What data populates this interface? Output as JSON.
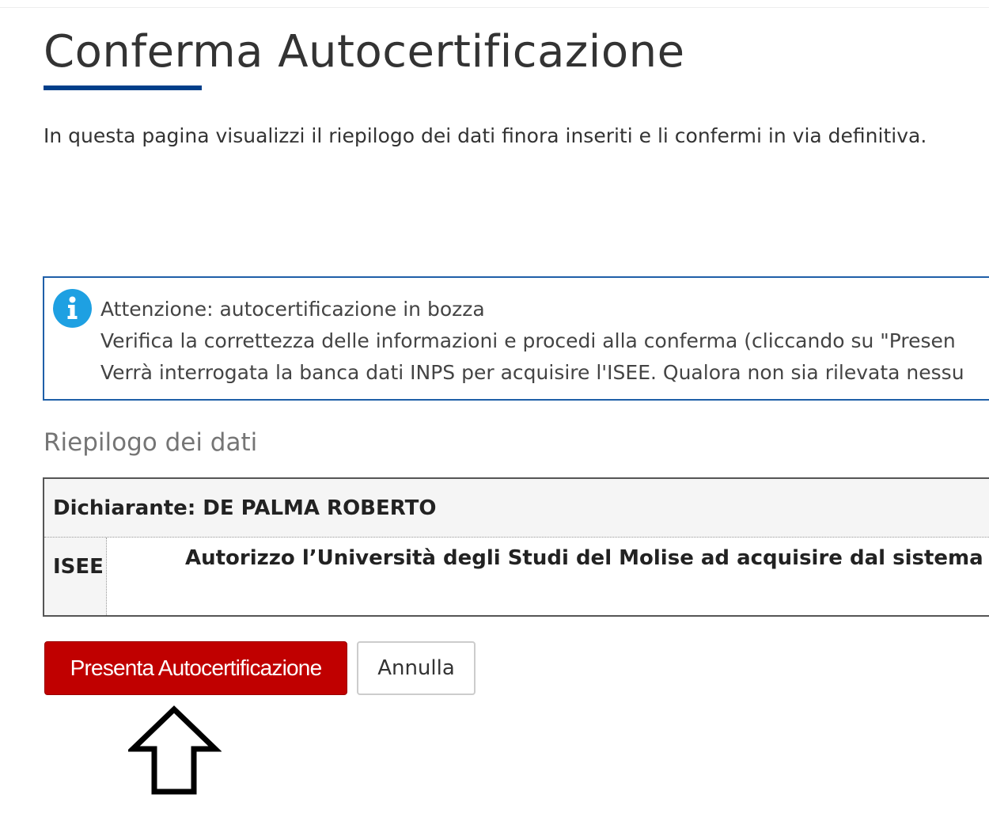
{
  "page": {
    "title": "Conferma Autocertificazione",
    "intro": "In questa pagina visualizzi il riepilogo dei dati finora inseriti e li confermi in via definitiva."
  },
  "info_box": {
    "icon": "info-icon",
    "icon_color": "#1ea0e2",
    "lines": [
      "Attenzione: autocertificazione in bozza",
      "Verifica la correttezza delle informazioni e procedi alla conferma (cliccando su \"Presen",
      "Verrà interrogata la banca dati INPS per acquisire l'ISEE. Qualora non sia rilevata nessu"
    ]
  },
  "summary": {
    "title": "Riepilogo dei dati",
    "header": "Dichiarante: DE PALMA ROBERTO",
    "rows": [
      {
        "label": "ISEE",
        "value": "Autorizzo l’Università degli Studi del Molise ad acquisire dal sistema infor"
      }
    ]
  },
  "actions": {
    "submit_label": "Presenta Autocertificazione",
    "cancel_label": "Annulla"
  },
  "colors": {
    "accent": "#003f8a",
    "primary_button": "#c00000",
    "info_border": "#1f5fa8"
  },
  "annotation": {
    "icon": "arrow-up-outline-icon"
  }
}
